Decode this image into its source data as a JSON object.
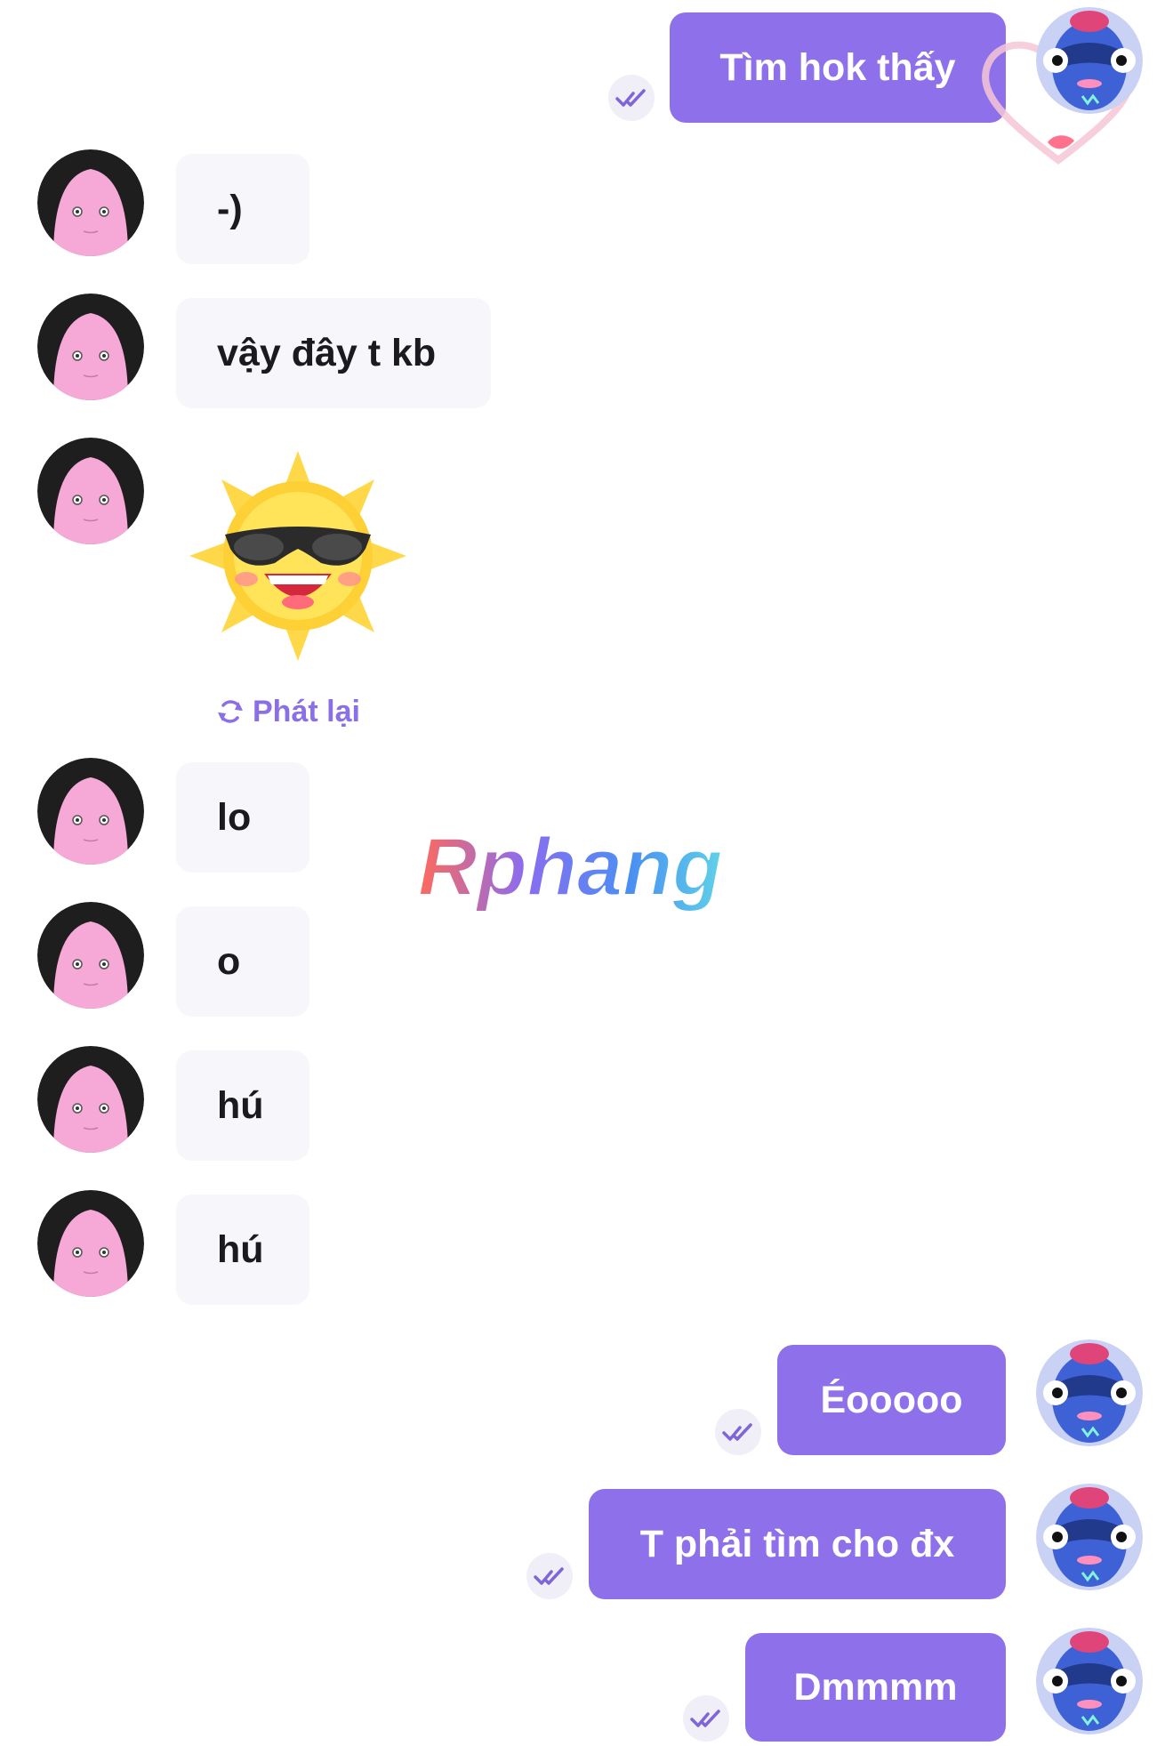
{
  "colors": {
    "outgoing_bubble": "#8e70ea",
    "incoming_bubble": "#f7f7fb",
    "accent": "#8b6fe6"
  },
  "icons": {
    "seen": "double-check-icon",
    "replay": "replay-icon",
    "avatar_self": "blue-face-avatar",
    "avatar_other": "pink-face-avatar",
    "sticker": "sun-sunglasses-sticker"
  },
  "messages": [
    {
      "side": "out",
      "text": "Tìm hok thấy"
    },
    {
      "side": "in",
      "text": "-)"
    },
    {
      "side": "in",
      "text": "vậy đây t kb"
    },
    {
      "side": "in",
      "type": "sticker"
    },
    {
      "side": "in",
      "text": "lo"
    },
    {
      "side": "in",
      "text": "o"
    },
    {
      "side": "in",
      "text": "hú"
    },
    {
      "side": "in",
      "text": "hú"
    },
    {
      "side": "out",
      "text": "Éooooo"
    },
    {
      "side": "out",
      "text": "T phải tìm cho đx"
    },
    {
      "side": "out",
      "text": "Dmmmm"
    }
  ],
  "sticker_action": "Phát lại",
  "watermark": "Rphang"
}
